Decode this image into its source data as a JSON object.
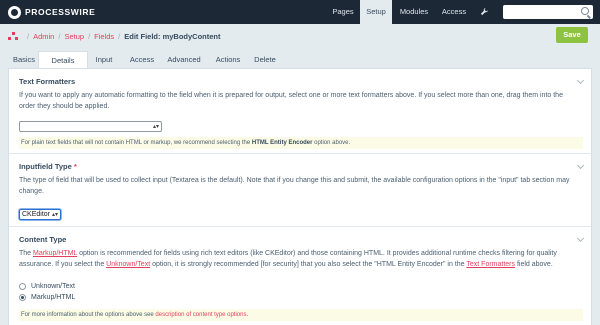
{
  "app": {
    "logo_text": "PROCESSWIRE"
  },
  "nav": {
    "items": [
      {
        "label": "Pages"
      },
      {
        "label": "Setup"
      },
      {
        "label": "Modules"
      },
      {
        "label": "Access"
      }
    ],
    "tools_icon": "wrench-icon",
    "search": {
      "placeholder": "",
      "value": "",
      "icon": "search-icon"
    }
  },
  "breadcrumb": {
    "items": [
      "Admin",
      "Setup",
      "Fields"
    ],
    "separator": "/",
    "page_title": "Edit Field: myBodyContent"
  },
  "save_label": "Save",
  "tabs": [
    {
      "label": "Basics"
    },
    {
      "label": "Details",
      "active": true
    },
    {
      "label": "Input"
    },
    {
      "label": "Access"
    },
    {
      "label": "Advanced"
    },
    {
      "label": "Actions"
    },
    {
      "label": "Delete"
    }
  ],
  "sections": {
    "text_formatters": {
      "title": "Text Formatters",
      "description": "If you want to apply any automatic formatting to the field when it is prepared for output, select one or more text formatters above. If you select more than one, drag them into the order they should be applied.",
      "select_value": "",
      "notes_prefix": "For plain text fields that will not contain HTML or markup, we recommend selecting the",
      "notes_bold": "HTML Entity Encoder",
      "notes_suffix": "option above."
    },
    "inputfield_type": {
      "title": "Inputfield Type",
      "required_mark": "*",
      "description": "The type of field that will be used to collect input (Textarea is the default). Note that if you change this and submit, the available configuration options in the \"input\" tab section may change.",
      "select_value": "CKEditor"
    },
    "content_type": {
      "title": "Content Type",
      "desc_1": "The",
      "link_markup": "Markup/HTML",
      "desc_2": "option is recommended for fields using rich text editors (like CKEditor) and those containing HTML. It provides additional runtime checks filtering for quality assurance. If you select the",
      "link_unknown": "Unknown/Text",
      "desc_3": "option, it is strongly recommended [for security] that you also select the \"HTML Entity Encoder\" in the",
      "link_formatters": "Text Formatters",
      "desc_4": "field above.",
      "options": [
        {
          "label": "Unknown/Text",
          "checked": false
        },
        {
          "label": "Markup/HTML",
          "checked": true
        }
      ],
      "notes_prefix": "For more information about the options above see",
      "notes_link": "description of content type options",
      "notes_suffix": "."
    }
  },
  "colors": {
    "topbar": "#1c2836",
    "accent": "#e0405d",
    "save_button": "#8dc33f",
    "background": "#e4ebee"
  }
}
